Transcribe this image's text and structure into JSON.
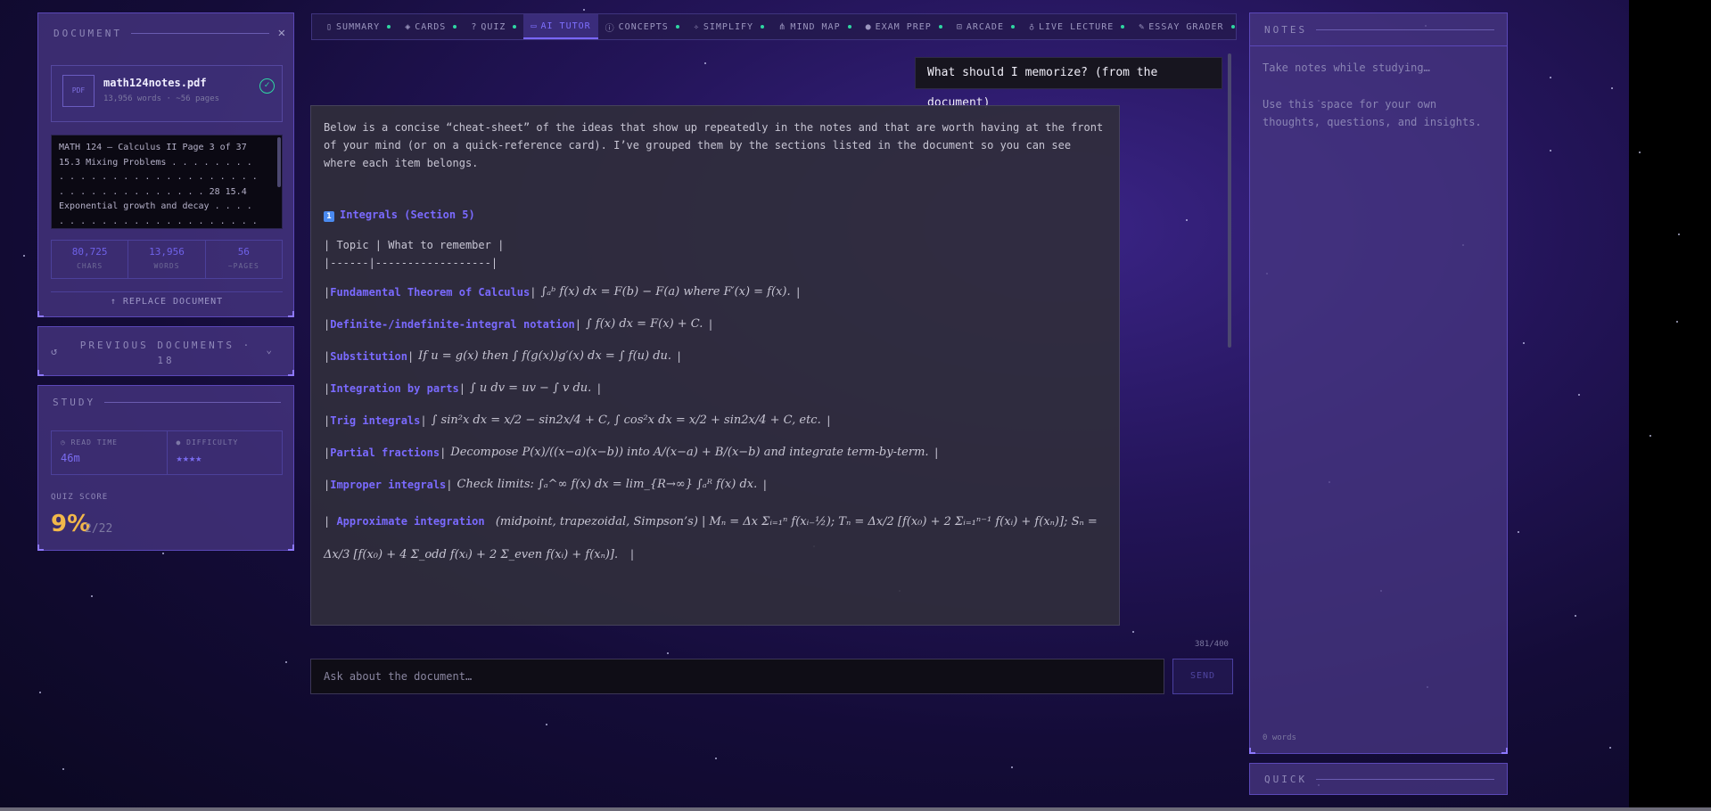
{
  "document_panel": {
    "title": "DOCUMENT",
    "close_icon": "close-icon",
    "file": {
      "badge": "PDF",
      "name": "math124notes.pdf",
      "meta": "13,956 words · ~56 pages"
    },
    "preview_lines": [
      "MATH 124 – Calculus II Page 3 of 37",
      "15.3 Mixing Problems . . . . . . . .",
      ". . . . . . . . . . . . . . . . . . .",
      ". . . . . . . . . . . . . . 28 15.4",
      "Exponential growth and decay . . . .",
      ". . . . . . . . . . . . . . . . . . ."
    ],
    "stats": [
      {
        "value": "80,725",
        "label": "CHARS"
      },
      {
        "value": "13,956",
        "label": "WORDS"
      },
      {
        "value": "56",
        "label": "~PAGES"
      }
    ],
    "replace_label": "↑ REPLACE DOCUMENT"
  },
  "previous_documents": {
    "label": "PREVIOUS DOCUMENTS · 18"
  },
  "study": {
    "title": "STUDY",
    "read_time_label": "READ TIME",
    "read_time_value": "46m",
    "difficulty_label": "DIFFICULTY",
    "difficulty_stars": "★★★★",
    "quiz_label": "QUIZ SCORE",
    "quiz_percent": "9%",
    "quiz_count": "2/22"
  },
  "tabs": [
    {
      "label": "SUMMARY",
      "icon": "book-icon",
      "active": false
    },
    {
      "label": "CARDS",
      "icon": "layers-icon",
      "active": false
    },
    {
      "label": "QUIZ",
      "icon": "question-icon",
      "active": false
    },
    {
      "label": "AI TUTOR",
      "icon": "chat-icon",
      "active": true
    },
    {
      "label": "CONCEPTS",
      "icon": "info-icon",
      "active": false
    },
    {
      "label": "SIMPLIFY",
      "icon": "sparkle-icon",
      "active": false
    },
    {
      "label": "MIND MAP",
      "icon": "network-icon",
      "active": false
    },
    {
      "label": "EXAM PREP",
      "icon": "circle-icon",
      "active": false
    },
    {
      "label": "ARCADE",
      "icon": "gamepad-icon",
      "active": false
    },
    {
      "label": "LIVE LECTURE",
      "icon": "mic-icon",
      "active": false
    },
    {
      "label": "ESSAY GRADER",
      "icon": "pen-icon",
      "active": false
    }
  ],
  "chat": {
    "user_message": "What should I memorize? (from the document)",
    "answer_intro": "Below is a concise “cheat-sheet” of the ideas that show up repeatedly in the notes and that are worth having at the front of your mind (or on a quick-reference card). I’ve grouped them by the sections listed in the document so you can see where each item belongs.",
    "section_number": "1",
    "section_heading": "Integrals (Section 5)",
    "table_header": "| Topic | What to remember |",
    "table_divider": "|------|------------------|",
    "rows": [
      {
        "pre": "| ",
        "topic": "Fundamental Theorem of Calculus",
        "sep": " | ",
        "content": "∫ₐᵇ f(x) dx = F(b) − F(a)  where  F′(x) = f(x).",
        "end": " |"
      },
      {
        "pre": "| ",
        "topic": "Definite-/indefinite-integral notation",
        "sep": " | ",
        "content": "∫ f(x) dx = F(x) + C.",
        "end": " |"
      },
      {
        "pre": "| ",
        "topic": "Substitution",
        "sep": " | ",
        "content": "If  u = g(x)  then  ∫ f(g(x))g′(x) dx = ∫ f(u) du.",
        "end": " |"
      },
      {
        "pre": "| ",
        "topic": "Integration by parts",
        "sep": " | ",
        "content": "∫ u dv = uv − ∫ v du.",
        "end": " |"
      },
      {
        "pre": "| ",
        "topic": "Trig integrals",
        "sep": " | ",
        "content": "∫ sin²x dx = x/2 − sin2x/4 + C,  ∫ cos²x dx = x/2 + sin2x/4 + C,  etc.",
        "end": " |"
      },
      {
        "pre": "| ",
        "topic": "Partial fractions",
        "sep": " | ",
        "content": "Decompose  P(x)/((x−a)(x−b))  into  A/(x−a) + B/(x−b)  and integrate term-by-term.",
        "end": " |"
      },
      {
        "pre": "| ",
        "topic": "Improper integrals",
        "sep": " | ",
        "content": "Check limits:  ∫ₐ^∞ f(x) dx = lim_{R→∞} ∫ₐᴿ f(x) dx.",
        "end": " |"
      },
      {
        "pre": "| ",
        "topic": "Approximate integration",
        "sep": " ",
        "content": "(midpoint, trapezoidal, Simpson’s) | Mₙ = Δx Σᵢ₌₁ⁿ f(xᵢ₋½);  Tₙ = Δx/2 [f(x₀) + 2 Σᵢ₌₁ⁿ⁻¹ f(xᵢ) + f(xₙ)];  Sₙ = Δx/3 [f(x₀) + 4 Σ_odd f(xᵢ) + 2 Σ_even f(xᵢ) + f(xₙ)].",
        "end": " |"
      }
    ],
    "char_count": "381/400",
    "input_placeholder": "Ask about the document…",
    "send_label": "SEND"
  },
  "notes": {
    "title": "NOTES",
    "placeholder_1": "Take notes while studying…",
    "placeholder_2": "Use this space for your own thoughts, questions, and insights.",
    "word_count": "0 words"
  },
  "quick": {
    "title": "QUICK"
  }
}
